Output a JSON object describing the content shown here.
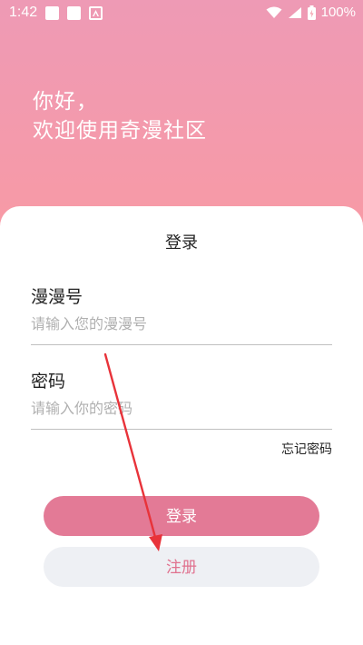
{
  "status_bar": {
    "time": "1:42",
    "battery": "100%"
  },
  "greeting": {
    "line1": "你好，",
    "line2": "欢迎使用奇漫社区"
  },
  "login_card": {
    "title": "登录",
    "account_label": "漫漫号",
    "account_placeholder": "请输入您的漫漫号",
    "password_label": "密码",
    "password_placeholder": "请输入你的密码",
    "forgot_password": "忘记密码",
    "login_button": "登录",
    "register_button": "注册"
  },
  "colors": {
    "accent": "#e37a96",
    "annotation_arrow": "#e8333a"
  },
  "icons": [
    "wifi-icon",
    "signal-icon",
    "battery-icon"
  ]
}
